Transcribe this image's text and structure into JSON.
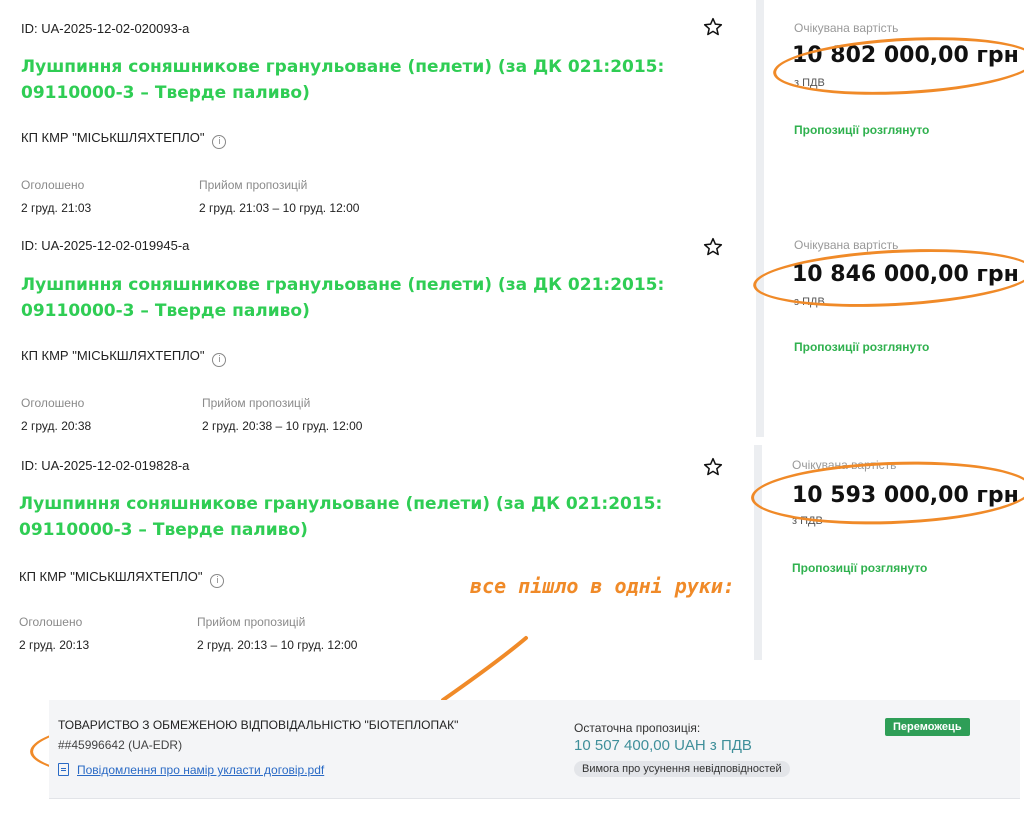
{
  "tenders": [
    {
      "id": "ID: UA-2025-12-02-020093-a",
      "title": "Лушпиння соняшникове гранульоване (пелети) (за ДК 021:2015: 09110000-3 – Тверде паливо)",
      "org": "КП КМР \"МІСЬКШЛЯХТЕПЛО\"",
      "announced_label": "Оголошено",
      "announced_value": "2 груд. 21:03",
      "acceptance_label": "Прийом пропозицій",
      "acceptance_value": "2 груд. 21:03 – 10 груд. 12:00",
      "expected_label": "Очікувана вартість",
      "expected_amount": "10 802 000,00 грн",
      "vat": "з ПДВ",
      "status": "Пропозиції розглянуто"
    },
    {
      "id": "ID: UA-2025-12-02-019945-a",
      "title": "Лушпиння соняшникове гранульоване (пелети) (за ДК 021:2015: 09110000-3 – Тверде паливо)",
      "org": "КП КМР \"МІСЬКШЛЯХТЕПЛО\"",
      "announced_label": "Оголошено",
      "announced_value": "2 груд. 20:38",
      "acceptance_label": "Прийом пропозицій",
      "acceptance_value": "2 груд. 20:38 – 10 груд. 12:00",
      "expected_label": "Очікувана вартість",
      "expected_amount": "10 846 000,00 грн",
      "vat": "з ПДВ",
      "status": "Пропозиції розглянуто"
    },
    {
      "id": "ID: UA-2025-12-02-019828-a",
      "title": "Лушпиння соняшникове гранульоване (пелети) (за ДК 021:2015: 09110000-3 – Тверде паливо)",
      "org": "КП КМР \"МІСЬКШЛЯХТЕПЛО\"",
      "announced_label": "Оголошено",
      "announced_value": "2 груд. 20:13",
      "acceptance_label": "Прийом пропозицій",
      "acceptance_value": "2 груд. 20:13 – 10 груд. 12:00",
      "expected_label": "Очікувана вартість",
      "expected_amount": "10 593 000,00 грн",
      "vat": "з ПДВ",
      "status": "Пропозиції розглянуто"
    }
  ],
  "annotation": "все пішло в одні руки:",
  "winner": {
    "company": "ТОВАРИСТВО З ОБМЕЖЕНОЮ ВІДПОВІДАЛЬНІСТЮ \"БІОТЕПЛОПАК\"",
    "code": "##45996642 (UA-EDR)",
    "document_link": "Повідомлення про намір укласти договір.pdf",
    "final_offer_label": "Остаточна пропозиція:",
    "final_offer_value": "10 507 400,00 UAH з ПДВ",
    "claim": "Вимога про усунення невідповідностей",
    "badge": "Переможець"
  },
  "colors": {
    "title_green": "#2fcd54",
    "status_green": "#2fb14e",
    "annotation_orange": "#f08a28",
    "winner_badge": "#2e9e57",
    "link_blue": "#2a6ac5"
  }
}
